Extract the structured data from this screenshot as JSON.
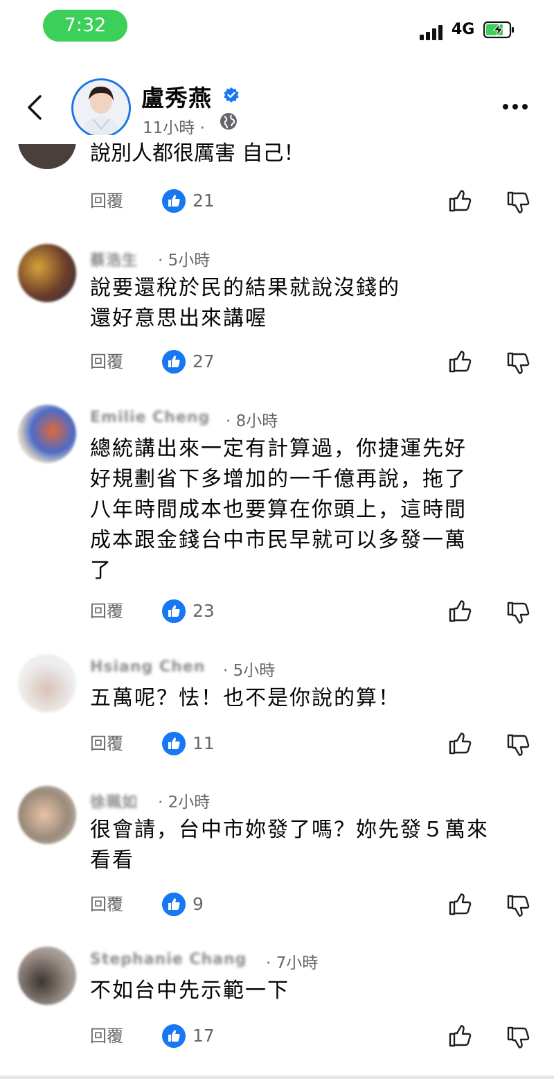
{
  "status_bar": {
    "time": "7:32",
    "network": "4G"
  },
  "post": {
    "author": "盧秀燕",
    "time": "11小時 · "
  },
  "partial_comment": {
    "text": "說別人都很厲害 自己！"
  },
  "actions": {
    "reply_label": "回覆"
  },
  "comments": [
    {
      "name": "蔡浩生",
      "time": "· 5小時",
      "lines": [
        "說要還稅於民的結果就說沒錢的",
        "還好意思出來講喔"
      ],
      "likes": "27"
    },
    {
      "name": "Emilie Cheng",
      "time": "· 8小時",
      "lines": [
        "總統講出來一定有計算過，你捷運先好",
        "好規劃省下多增加的一千億再說，拖了",
        "八年時間成本也要算在你頭上，這時間",
        "成本跟金錢台中市民早就可以多發一萬",
        "了"
      ],
      "likes": "23"
    },
    {
      "name": "Hsiang Chen",
      "time": "· 5小時",
      "lines": [
        "五萬呢？怯！也不是你說的算！"
      ],
      "likes": "11"
    },
    {
      "name": "徐珮如",
      "time": "· 2小時",
      "lines": [
        "很會請，台中市妳發了嗎？妳先發５萬來",
        "看看"
      ],
      "likes": "9"
    },
    {
      "name": "Stephanie Chang",
      "time": "· 7小時",
      "lines": [
        "不如台中先示範一下"
      ],
      "likes": "17"
    }
  ],
  "first_likes": "21",
  "colors": {
    "accent": "#1877f2",
    "pill": "#3ccf5a"
  }
}
